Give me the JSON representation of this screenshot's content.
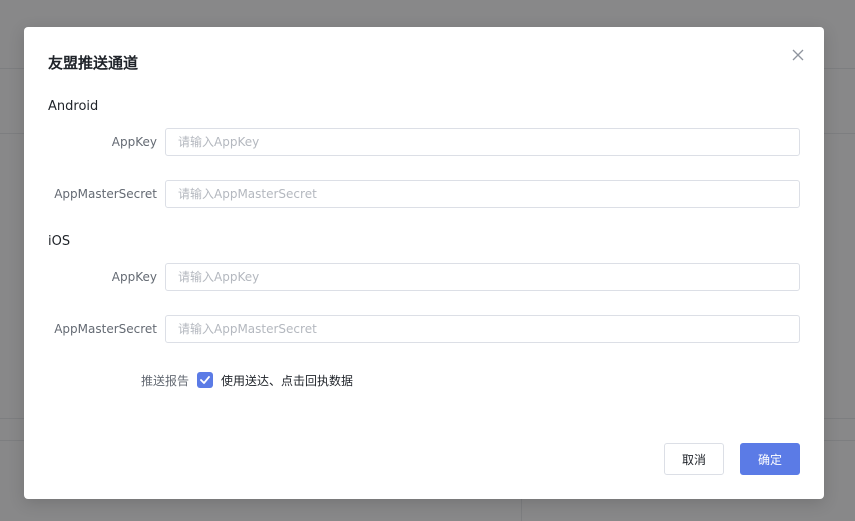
{
  "dialog": {
    "title": "友盟推送通道",
    "close_icon": "close-icon"
  },
  "android": {
    "section_title": "Android",
    "appkey": {
      "label": "AppKey",
      "value": "",
      "placeholder": "请输入AppKey"
    },
    "master_secret": {
      "label": "AppMasterSecret",
      "value": "",
      "placeholder": "请输入AppMasterSecret"
    }
  },
  "ios": {
    "section_title": "iOS",
    "appkey": {
      "label": "AppKey",
      "value": "",
      "placeholder": "请输入AppKey"
    },
    "master_secret": {
      "label": "AppMasterSecret",
      "value": "",
      "placeholder": "请输入AppMasterSecret"
    }
  },
  "push_report": {
    "label": "推送报告",
    "checked": true,
    "option_text": "使用送达、点击回执数据"
  },
  "footer": {
    "cancel_label": "取消",
    "ok_label": "确定"
  },
  "colors": {
    "primary": "#5b7be6",
    "overlay": "rgba(0,0,0,0.45)"
  }
}
